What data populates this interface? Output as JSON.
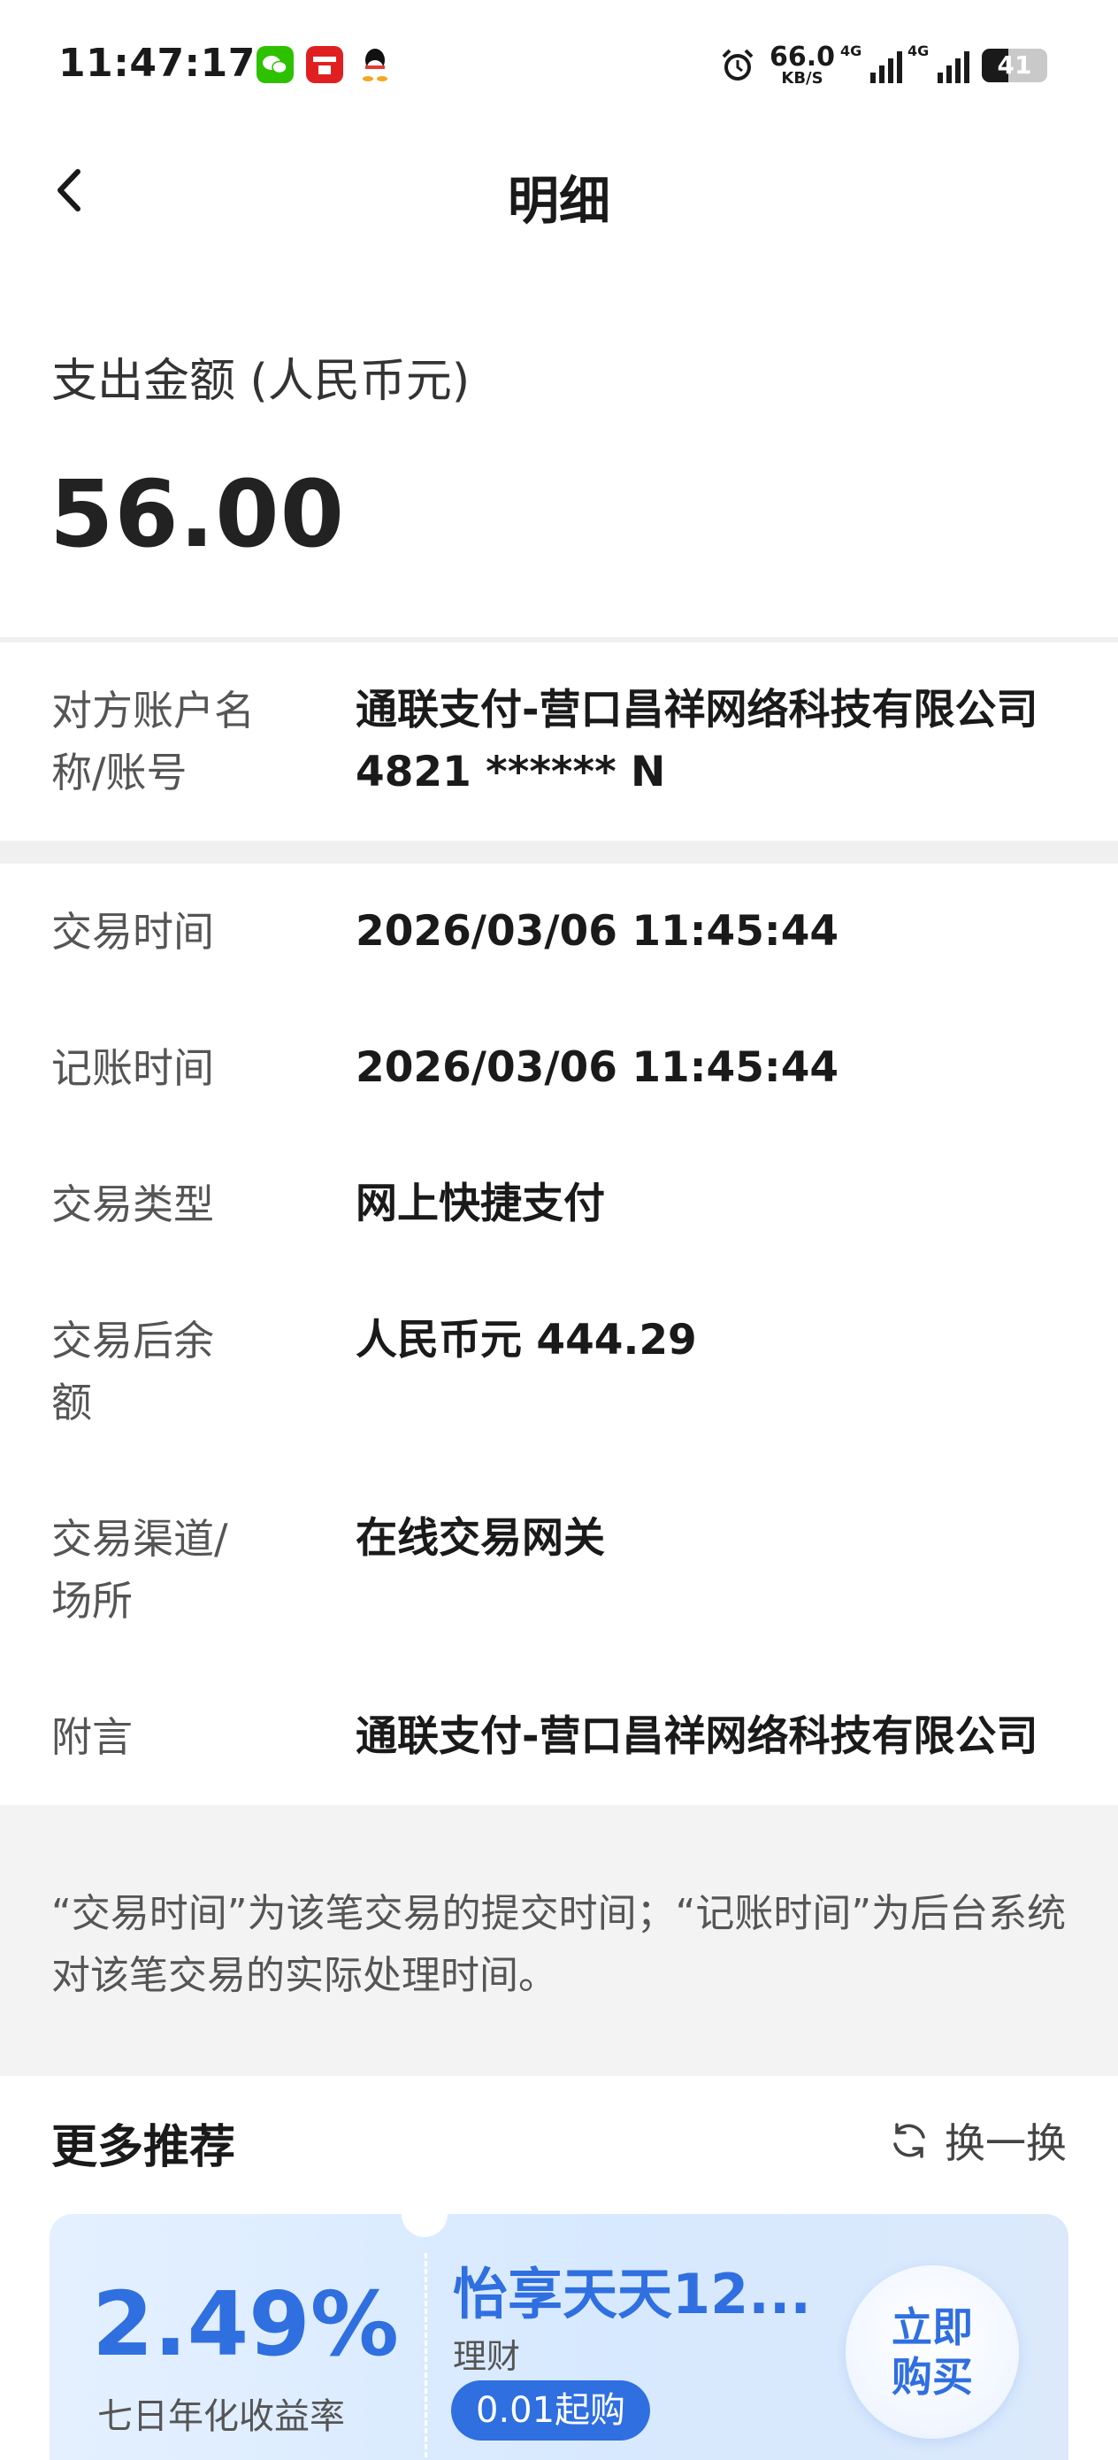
{
  "status_bar": {
    "time": "11:47:17",
    "net_speed_value": "66.0",
    "net_speed_unit": "KB/S",
    "signal1_tag": "4G",
    "signal2_tag": "4G",
    "battery_level": "41"
  },
  "header": {
    "title": "明细"
  },
  "amount": {
    "label": "支出金额 (人民币元)",
    "value": "56.00"
  },
  "counterparty": {
    "label": "对方账户名称/账号",
    "name": "通联支付-营口昌祥网络科技有限公司",
    "account": "4821 ****** N"
  },
  "details": [
    {
      "label": "交易时间",
      "value": "2026/03/06 11:45:44"
    },
    {
      "label": "记账时间",
      "value": "2026/03/06 11:45:44"
    },
    {
      "label": "交易类型",
      "value": "网上快捷支付"
    },
    {
      "label": "交易后余额",
      "value": "人民币元 444.29"
    },
    {
      "label": "交易渠道/场所",
      "value": "在线交易网关"
    },
    {
      "label": "附言",
      "value": "通联支付-营口昌祥网络科技有限公司"
    }
  ],
  "note": "“交易时间”为该笔交易的提交时间；“记账时间”为后台系统对该笔交易的实际处理时间。",
  "recommend": {
    "title": "更多推荐",
    "refresh_label": "换一换"
  },
  "promo": {
    "rate": "2.49%",
    "rate_label": "七日年化收益率",
    "name": "怡享天天12...",
    "category": "理财",
    "min_purchase": "0.01起购",
    "buy_label": "立即购买"
  },
  "colors": {
    "accent": "#2f6fe0",
    "divider": "#f0f0f0"
  }
}
